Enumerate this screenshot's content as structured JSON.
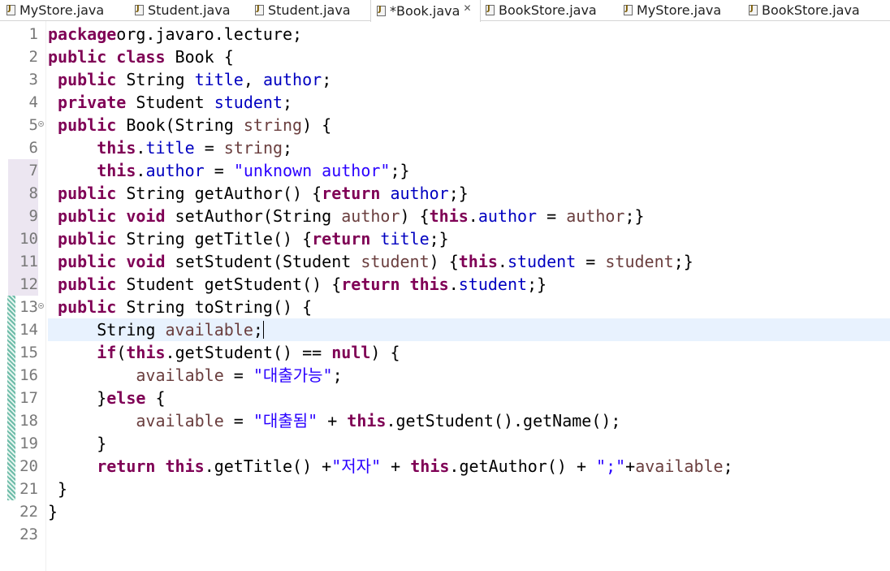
{
  "tabs": [
    {
      "label": "MyStore.java",
      "active": false,
      "close": ""
    },
    {
      "label": "Student.java",
      "active": false,
      "close": ""
    },
    {
      "label": "Student.java",
      "active": false,
      "close": ""
    },
    {
      "label": "*Book.java",
      "active": true,
      "close": "✕"
    },
    {
      "label": "BookStore.java",
      "active": false,
      "close": ""
    },
    {
      "label": "MyStore.java",
      "active": false,
      "close": ""
    },
    {
      "label": "BookStore.java",
      "active": false,
      "close": ""
    }
  ],
  "editor": {
    "current_line": 14,
    "lines": [
      {
        "num": "1",
        "tokens": [
          [
            "kw",
            "package"
          ],
          [
            "",
            "org.javaro.lecture;"
          ]
        ]
      },
      {
        "num": "2",
        "tokens": [
          [
            "kw",
            "public class"
          ],
          [
            "",
            " Book {"
          ]
        ]
      },
      {
        "num": "3",
        "tokens": [
          [
            "",
            " "
          ],
          [
            "kw",
            "public"
          ],
          [
            "",
            " String "
          ],
          [
            "fld",
            "title"
          ],
          [
            "",
            ", "
          ],
          [
            "fld",
            "author"
          ],
          [
            "",
            ";"
          ]
        ]
      },
      {
        "num": "4",
        "tokens": [
          [
            "",
            " "
          ],
          [
            "kw",
            "private"
          ],
          [
            "",
            " Student "
          ],
          [
            "fld",
            "student"
          ],
          [
            "",
            ";"
          ]
        ]
      },
      {
        "num": "5",
        "tokens": [
          [
            "",
            " "
          ],
          [
            "kw",
            "public"
          ],
          [
            "",
            " Book(String "
          ],
          [
            "var",
            "string"
          ],
          [
            "",
            ") {"
          ]
        ]
      },
      {
        "num": "6",
        "tokens": [
          [
            "",
            "     "
          ],
          [
            "kw",
            "this"
          ],
          [
            "",
            "."
          ],
          [
            "fld",
            "title"
          ],
          [
            "",
            " = "
          ],
          [
            "var",
            "string"
          ],
          [
            "",
            ";"
          ]
        ]
      },
      {
        "num": "7",
        "tokens": [
          [
            "",
            "     "
          ],
          [
            "kw",
            "this"
          ],
          [
            "",
            "."
          ],
          [
            "fld",
            "author"
          ],
          [
            "",
            " = "
          ],
          [
            "str",
            "\"unknown author\""
          ],
          [
            "",
            ";}"
          ]
        ]
      },
      {
        "num": "8",
        "tokens": [
          [
            "",
            " "
          ],
          [
            "kw",
            "public"
          ],
          [
            "",
            " String getAuthor() {"
          ],
          [
            "kw",
            "return"
          ],
          [
            "",
            " "
          ],
          [
            "fld",
            "author"
          ],
          [
            "",
            ";}"
          ]
        ]
      },
      {
        "num": "9",
        "tokens": [
          [
            "",
            " "
          ],
          [
            "kw",
            "public void"
          ],
          [
            "",
            " setAuthor(String "
          ],
          [
            "var",
            "author"
          ],
          [
            "",
            ") {"
          ],
          [
            "kw",
            "this"
          ],
          [
            "",
            "."
          ],
          [
            "fld",
            "author"
          ],
          [
            "",
            " = "
          ],
          [
            "var",
            "author"
          ],
          [
            "",
            ";}"
          ]
        ]
      },
      {
        "num": "10",
        "tokens": [
          [
            "",
            " "
          ],
          [
            "kw",
            "public"
          ],
          [
            "",
            " String getTitle() {"
          ],
          [
            "kw",
            "return"
          ],
          [
            "",
            " "
          ],
          [
            "fld",
            "title"
          ],
          [
            "",
            ";}"
          ]
        ]
      },
      {
        "num": "11",
        "tokens": [
          [
            "",
            " "
          ],
          [
            "kw",
            "public void"
          ],
          [
            "",
            " setStudent(Student "
          ],
          [
            "var",
            "student"
          ],
          [
            "",
            ") {"
          ],
          [
            "kw",
            "this"
          ],
          [
            "",
            "."
          ],
          [
            "fld",
            "student"
          ],
          [
            "",
            " = "
          ],
          [
            "var",
            "student"
          ],
          [
            "",
            ";}"
          ]
        ]
      },
      {
        "num": "12",
        "tokens": [
          [
            "",
            " "
          ],
          [
            "kw",
            "public"
          ],
          [
            "",
            " Student getStudent() {"
          ],
          [
            "kw",
            "return"
          ],
          [
            "",
            " "
          ],
          [
            "kw",
            "this"
          ],
          [
            "",
            "."
          ],
          [
            "fld",
            "student"
          ],
          [
            "",
            ";}"
          ]
        ]
      },
      {
        "num": "13",
        "tokens": [
          [
            "",
            " "
          ],
          [
            "kw",
            "public"
          ],
          [
            "",
            " String toString() {"
          ]
        ]
      },
      {
        "num": "14",
        "tokens": [
          [
            "",
            "     String "
          ],
          [
            "var",
            "available"
          ],
          [
            "",
            ";"
          ]
        ]
      },
      {
        "num": "15",
        "tokens": [
          [
            "",
            "     "
          ],
          [
            "kw",
            "if"
          ],
          [
            "",
            "("
          ],
          [
            "kw",
            "this"
          ],
          [
            "",
            ".getStudent() == "
          ],
          [
            "kw",
            "null"
          ],
          [
            "",
            ") {"
          ]
        ]
      },
      {
        "num": "16",
        "tokens": [
          [
            "",
            "         "
          ],
          [
            "var",
            "available"
          ],
          [
            "",
            " = "
          ],
          [
            "str",
            "\"대출가능\""
          ],
          [
            "",
            ";"
          ]
        ]
      },
      {
        "num": "17",
        "tokens": [
          [
            "",
            "     }"
          ],
          [
            "kw",
            "else"
          ],
          [
            "",
            " {"
          ]
        ]
      },
      {
        "num": "18",
        "tokens": [
          [
            "",
            "         "
          ],
          [
            "var",
            "available"
          ],
          [
            "",
            " = "
          ],
          [
            "str",
            "\"대출됨\""
          ],
          [
            "",
            " + "
          ],
          [
            "kw",
            "this"
          ],
          [
            "",
            ".getStudent().getName();"
          ]
        ]
      },
      {
        "num": "19",
        "tokens": [
          [
            "",
            "     }"
          ]
        ]
      },
      {
        "num": "20",
        "tokens": [
          [
            "",
            "     "
          ],
          [
            "kw",
            "return"
          ],
          [
            "",
            " "
          ],
          [
            "kw",
            "this"
          ],
          [
            "",
            ".getTitle() +"
          ],
          [
            "str",
            "\"저자\""
          ],
          [
            "",
            " + "
          ],
          [
            "kw",
            "this"
          ],
          [
            "",
            ".getAuthor() + "
          ],
          [
            "str",
            "\";\""
          ],
          [
            "",
            "+"
          ],
          [
            "var",
            "available"
          ],
          [
            "",
            ";"
          ]
        ]
      },
      {
        "num": "21",
        "tokens": [
          [
            "",
            " }"
          ]
        ]
      },
      {
        "num": "22",
        "tokens": [
          [
            "",
            "}"
          ]
        ]
      },
      {
        "num": "23",
        "tokens": []
      }
    ]
  }
}
